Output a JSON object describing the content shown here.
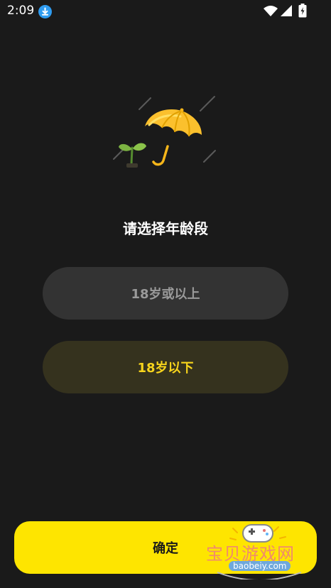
{
  "status_bar": {
    "time": "2:09",
    "icons": [
      "download-icon",
      "wifi-icon",
      "signal-icon",
      "battery-icon"
    ]
  },
  "illustration": {
    "icons": [
      "sprout-icon",
      "umbrella-icon",
      "rain-icon"
    ],
    "colors": {
      "umbrella": "#fbc02d",
      "sprout": "#7cb342"
    }
  },
  "title": "请选择年龄段",
  "options": [
    {
      "label": "18岁或以上",
      "selected": false
    },
    {
      "label": "18岁以下",
      "selected": true
    }
  ],
  "confirm_label": "确定",
  "watermark": {
    "text": "宝贝游戏网",
    "url": "baobeiy.com"
  },
  "colors": {
    "background": "#1a1a1a",
    "accent": "#fee500",
    "selected_text": "#f7d41c",
    "unselected_text": "#9a9a9a"
  }
}
